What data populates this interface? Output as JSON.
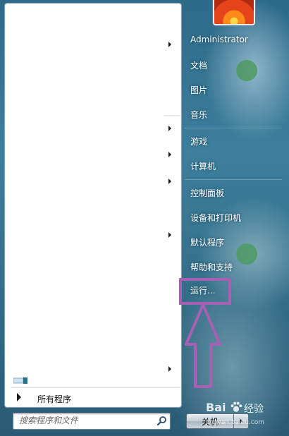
{
  "start_menu": {
    "left_pane": {
      "all_programs_label": "所有程序",
      "search": {
        "placeholder": "搜索程序和文件"
      }
    },
    "right_pane": {
      "user_name": "Administrator",
      "items": [
        {
          "label": "文档"
        },
        {
          "label": "图片"
        },
        {
          "label": "音乐"
        },
        {
          "label": "游戏"
        },
        {
          "label": "计算机"
        },
        {
          "label": "控制面板"
        },
        {
          "label": "设备和打印机"
        },
        {
          "label": "默认程序"
        },
        {
          "label": "帮助和支持"
        },
        {
          "label": "运行..."
        }
      ],
      "shutdown_label": "关机"
    }
  },
  "annotation": {
    "highlight_color": "#a860b4",
    "highlight_target": "运行..."
  },
  "watermark": {
    "text": "Bai",
    "text2": "经验",
    "url_fragment": "jingyan.baidu.com"
  }
}
